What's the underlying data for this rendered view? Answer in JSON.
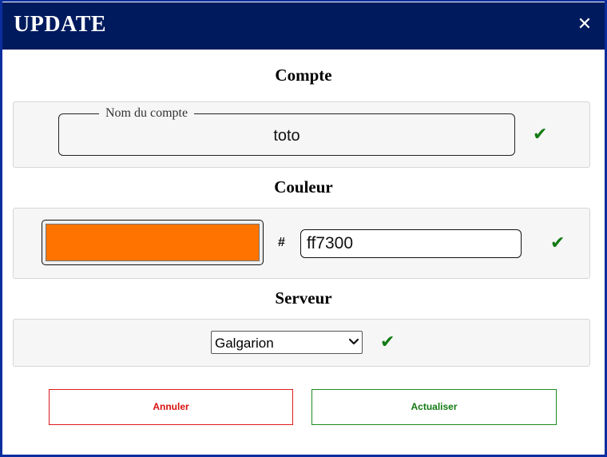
{
  "dialog": {
    "title": "UPDATE",
    "close_label": "✕"
  },
  "account": {
    "section_title": "Compte",
    "field_legend": "Nom du compte",
    "value": "toto",
    "valid_mark": "✔"
  },
  "color": {
    "section_title": "Couleur",
    "hash_label": "#",
    "hex_value": "ff7300",
    "swatch_color": "#ff7300",
    "valid_mark": "✔"
  },
  "server": {
    "section_title": "Serveur",
    "selected": "Galgarion",
    "valid_mark": "✔"
  },
  "actions": {
    "cancel_label": "Annuler",
    "update_label": "Actualiser"
  },
  "theme": {
    "titlebar_color": "#001a5e",
    "frame_color": "#0a2e9e",
    "cancel_color": "#d81010",
    "confirm_color": "#137a13"
  }
}
